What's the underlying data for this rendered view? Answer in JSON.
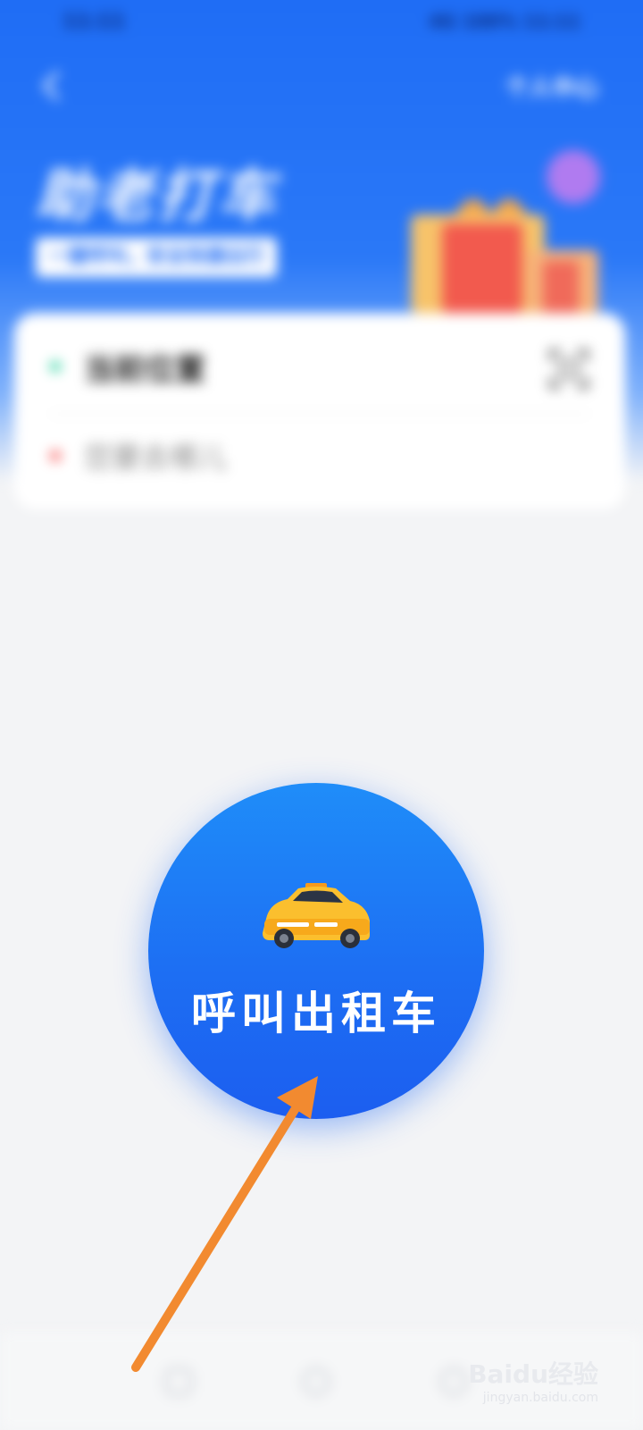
{
  "status_bar": {
    "time": "11:11",
    "right_info": "4G 100% 11:11"
  },
  "header": {
    "back_icon": "chevron-left-icon",
    "top_right_link": "个人中心"
  },
  "hero": {
    "title": "助老打车",
    "subtitle": "一键呼叫，安全快捷出行",
    "gift_icon": "gift-box-icon",
    "accent_icon": "purple-badge-icon"
  },
  "address_card": {
    "start_label": "当前位置",
    "end_placeholder": "您要去哪儿",
    "scan_icon": "scan-icon",
    "start_dot_color": "#2fd3a1",
    "end_dot_color": "#f86161"
  },
  "call_button": {
    "label": "呼叫出租车",
    "icon": "taxi-icon",
    "color": "#1d6ff3"
  },
  "annotation": {
    "arrow_color": "#f28a30",
    "arrow_icon": "pointer-arrow-icon"
  },
  "bottom_nav": {
    "items": [
      {
        "icon": "home-icon"
      },
      {
        "icon": "orders-icon"
      },
      {
        "icon": "profile-icon"
      }
    ]
  },
  "watermark": {
    "brand": "Baidu经验",
    "url": "jingyan.baidu.com"
  }
}
